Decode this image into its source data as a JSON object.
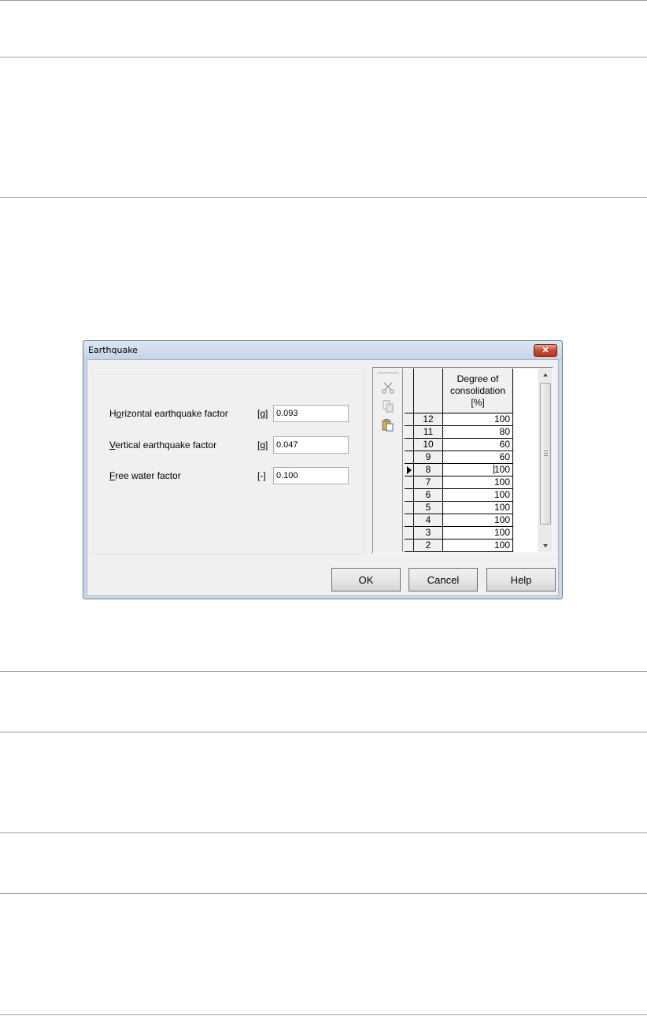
{
  "dialog": {
    "title": "Earthquake",
    "close_glyph": "✕"
  },
  "fields": {
    "horizontal": {
      "label_pre": "H",
      "label_mnemonic": "o",
      "label_post": "rizontal earthquake factor",
      "unit": "[g]",
      "value": "0.093"
    },
    "vertical": {
      "label_pre": "",
      "label_mnemonic": "V",
      "label_post": "ertical earthquake factor",
      "unit": "[g]",
      "value": "0.047"
    },
    "free_water": {
      "label_pre": "",
      "label_mnemonic": "F",
      "label_post": "ree water factor",
      "unit": "[-]",
      "value": "0.100"
    }
  },
  "toolbar": {
    "icons": [
      "cut-icon",
      "copy-icon",
      "paste-icon"
    ]
  },
  "table": {
    "header_line1": "Degree of",
    "header_line2": "consolidation",
    "header_line3": "[%]",
    "rows": [
      {
        "num": "12",
        "value": "100"
      },
      {
        "num": "11",
        "value": "80"
      },
      {
        "num": "10",
        "value": "60"
      },
      {
        "num": "9",
        "value": "60"
      },
      {
        "num": "8",
        "value": "100"
      },
      {
        "num": "7",
        "value": "100"
      },
      {
        "num": "6",
        "value": "100"
      },
      {
        "num": "5",
        "value": "100"
      },
      {
        "num": "4",
        "value": "100"
      },
      {
        "num": "3",
        "value": "100"
      },
      {
        "num": "2",
        "value": "100"
      }
    ],
    "current_row": 4
  },
  "buttons": {
    "ok": "OK",
    "cancel": "Cancel",
    "help": "Help"
  }
}
